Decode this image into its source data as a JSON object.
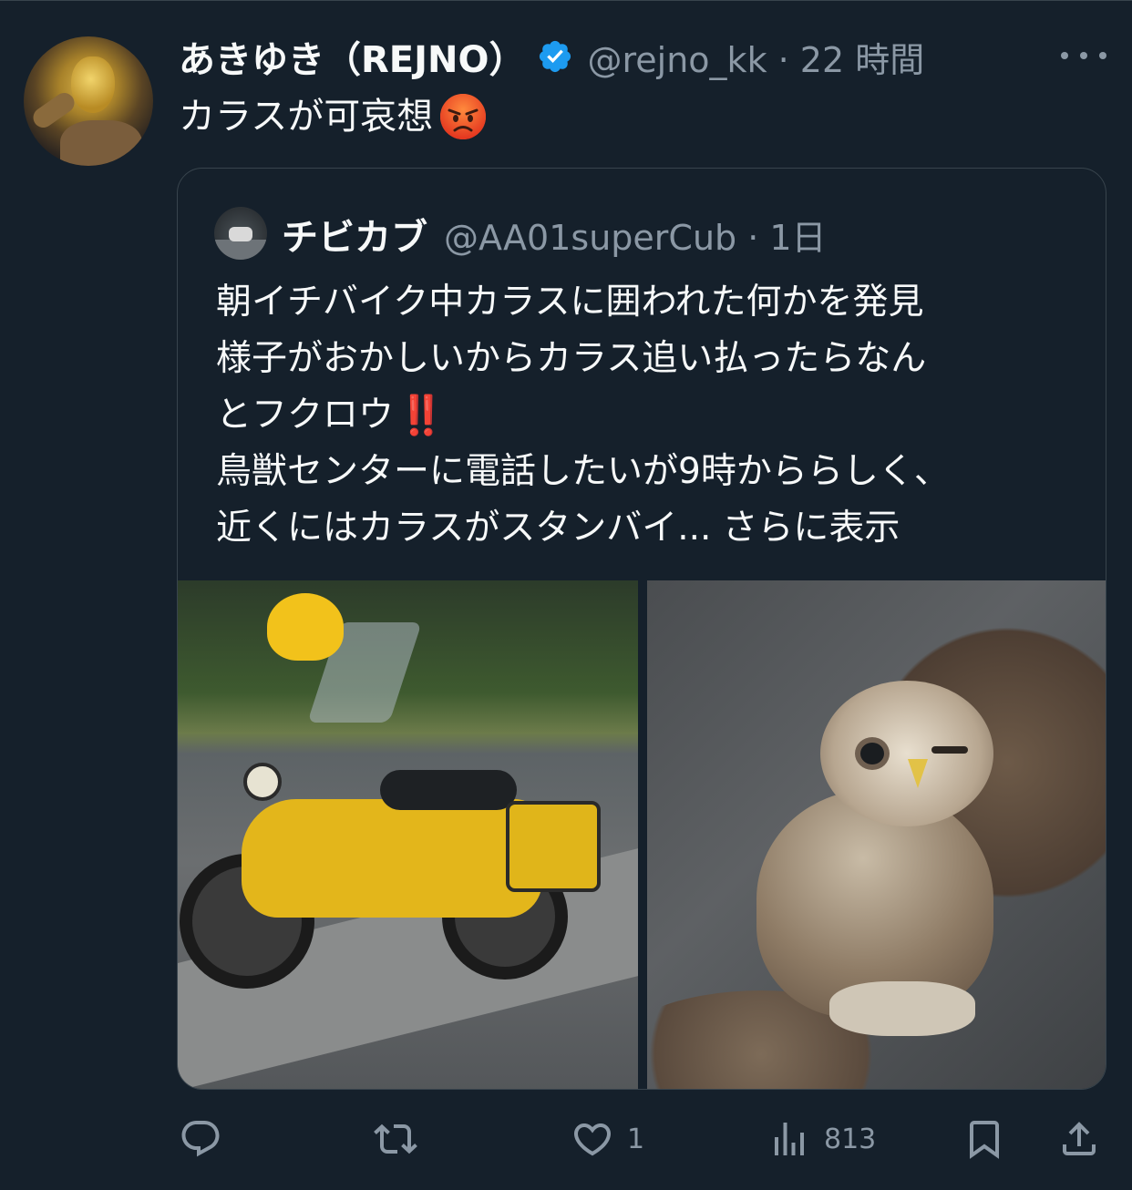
{
  "tweet": {
    "author": {
      "display_name": "あきゆき（REJNO）",
      "handle_time": "@rejno_kk · 22 時間"
    },
    "text": "カラスが可哀想",
    "emoji": "angry-face-emoji"
  },
  "quoted": {
    "author": {
      "display_name": "チビカブ",
      "handle_time": "@AA01superCub · 1日"
    },
    "lines": [
      "朝イチバイク中カラスに囲われた何かを発見",
      "様子がおかしいからカラス追い払ったらなん",
      "とフクロウ",
      "鳥獣センターに電話したいが9時かららしく、",
      "近くにはカラスがスタンバイ..."
    ],
    "emphasis": "‼️",
    "show_more": "さらに表示"
  },
  "actions": {
    "reply": {
      "icon": "reply-icon",
      "count": ""
    },
    "retweet": {
      "icon": "retweet-icon",
      "count": ""
    },
    "like": {
      "icon": "heart-icon",
      "count": "1"
    },
    "views": {
      "icon": "analytics-icon",
      "count": "813"
    },
    "bookmark": {
      "icon": "bookmark-icon"
    },
    "share": {
      "icon": "share-icon"
    }
  },
  "colors": {
    "background": "#15202b",
    "text": "#f7f9f9",
    "secondary": "#8b98a5",
    "verified": "#1d9bf0",
    "border": "#38444d"
  }
}
